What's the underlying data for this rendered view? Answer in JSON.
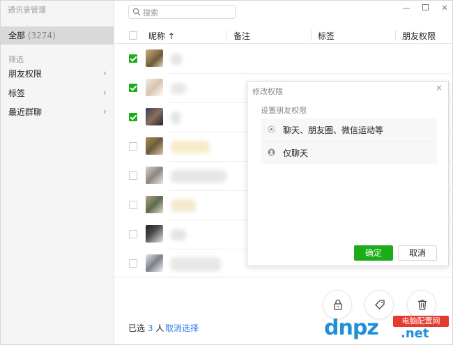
{
  "app": {
    "title": "通讯录管理"
  },
  "sidebar": {
    "all_label": "全部",
    "all_count": "(3274)",
    "filter_section": "筛选",
    "items": [
      {
        "label": "朋友权限"
      },
      {
        "label": "标签"
      },
      {
        "label": "最近群聊"
      }
    ]
  },
  "search": {
    "placeholder": "搜索"
  },
  "table": {
    "columns": [
      "昵称 ↑",
      "备注",
      "标签",
      "朋友权限"
    ],
    "rows": [
      {
        "checked": true
      },
      {
        "checked": true
      },
      {
        "checked": true
      },
      {
        "checked": false
      },
      {
        "checked": false
      },
      {
        "checked": false
      },
      {
        "checked": false
      },
      {
        "checked": false
      }
    ]
  },
  "footer": {
    "selected_prefix": "已选",
    "selected_count": "3",
    "selected_suffix": "人",
    "cancel_selection": "取消选择"
  },
  "dialog": {
    "title": "修改权限",
    "subtitle": "设置朋友权限",
    "options": [
      {
        "label": "聊天、朋友圈、微信运动等",
        "icon": "asterisk-icon"
      },
      {
        "label": "仅聊天",
        "icon": "person-icon"
      }
    ],
    "ok": "确定",
    "cancel": "取消"
  },
  "watermark": {
    "logo": "dnpz",
    "badge": "电脑配置网",
    "suffix": ".net"
  },
  "colors": {
    "accent": "#1aad19",
    "link": "#2a7be4",
    "sidebar_bg": "#f5f5f5"
  }
}
